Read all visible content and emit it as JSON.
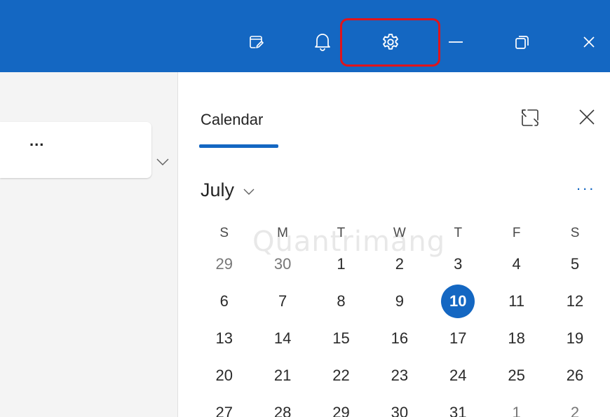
{
  "titlebar": {
    "background": "#1467c2",
    "buttons": [
      {
        "id": "todo",
        "icon": "todo-check-icon"
      },
      {
        "id": "notifications",
        "icon": "bell-icon"
      },
      {
        "id": "settings",
        "icon": "gear-icon",
        "highlight_color": "#e0141b"
      },
      {
        "id": "minimize",
        "icon": "minimize-icon"
      },
      {
        "id": "maximize",
        "icon": "restore-icon"
      },
      {
        "id": "close",
        "icon": "close-icon"
      }
    ]
  },
  "left_pane": {
    "card_more": "...",
    "chevron": "chevron-down-icon"
  },
  "calendar": {
    "title": "Calendar",
    "accent": "#1467c2",
    "month": "July",
    "more": "...",
    "weekdays": [
      "S",
      "M",
      "T",
      "W",
      "T",
      "F",
      "S"
    ],
    "weeks": [
      [
        {
          "d": "29",
          "muted": true
        },
        {
          "d": "30",
          "muted": true
        },
        {
          "d": "1"
        },
        {
          "d": "2"
        },
        {
          "d": "3"
        },
        {
          "d": "4"
        },
        {
          "d": "5"
        }
      ],
      [
        {
          "d": "6"
        },
        {
          "d": "7"
        },
        {
          "d": "8"
        },
        {
          "d": "9"
        },
        {
          "d": "10",
          "today": true
        },
        {
          "d": "11"
        },
        {
          "d": "12"
        }
      ],
      [
        {
          "d": "13"
        },
        {
          "d": "14"
        },
        {
          "d": "15"
        },
        {
          "d": "16"
        },
        {
          "d": "17"
        },
        {
          "d": "18"
        },
        {
          "d": "19"
        }
      ],
      [
        {
          "d": "20"
        },
        {
          "d": "21"
        },
        {
          "d": "22"
        },
        {
          "d": "23"
        },
        {
          "d": "24"
        },
        {
          "d": "25"
        },
        {
          "d": "26"
        }
      ],
      [
        {
          "d": "27"
        },
        {
          "d": "28"
        },
        {
          "d": "29"
        },
        {
          "d": "30"
        },
        {
          "d": "31"
        },
        {
          "d": "1",
          "muted": true
        },
        {
          "d": "2",
          "muted": true
        }
      ]
    ]
  },
  "watermark": "Quantrimang"
}
